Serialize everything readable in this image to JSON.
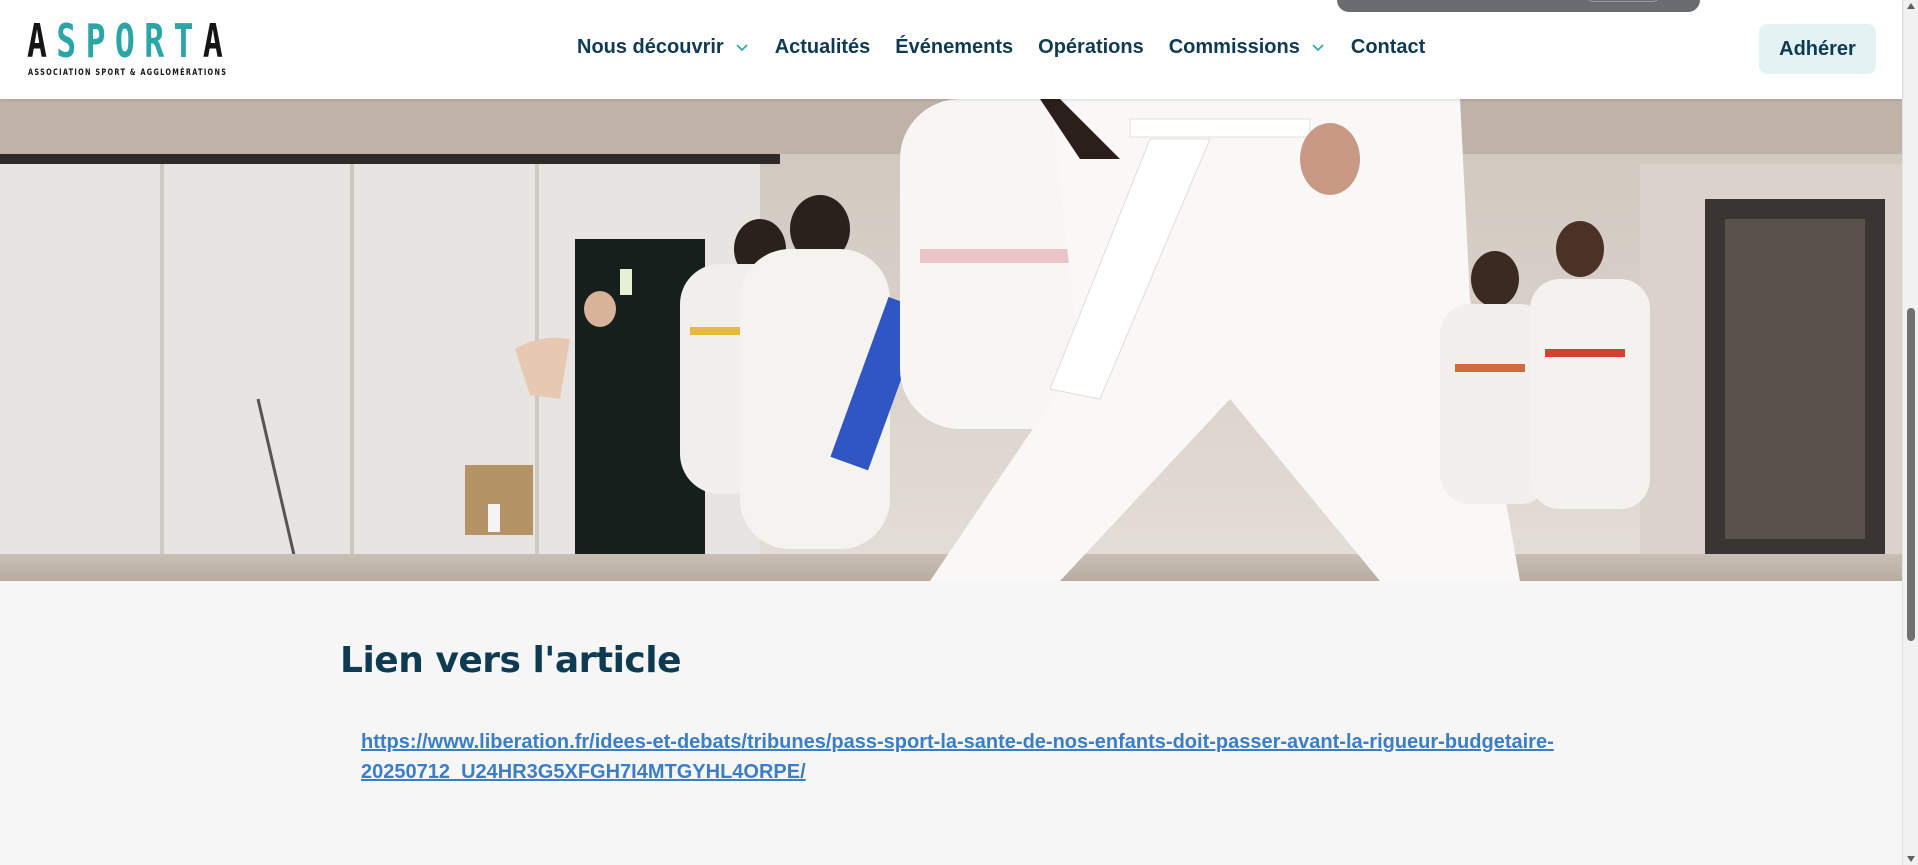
{
  "logo": {
    "word": "ASPORTA",
    "subtitle": "ASSOCIATION SPORT & AGGLOMÉRATIONS"
  },
  "nav": {
    "items": [
      {
        "label": "Nous découvrir",
        "has_dropdown": true
      },
      {
        "label": "Actualités",
        "has_dropdown": false
      },
      {
        "label": "Événements",
        "has_dropdown": false
      },
      {
        "label": "Opérations",
        "has_dropdown": false
      },
      {
        "label": "Commissions",
        "has_dropdown": true
      },
      {
        "label": "Contact",
        "has_dropdown": false
      }
    ]
  },
  "header": {
    "join_label": "Adhérer"
  },
  "hero": {
    "image_description_icon": "karate-class-photo"
  },
  "article": {
    "title": "Lien vers l'article",
    "link_text": "https://www.liberation.fr/idees-et-debats/tribunes/pass-sport-la-sante-de-nos-enfants-doit-passer-avant-la-rigueur-budgetaire-20250712_U24HR3G5XFGH7I4MTGYHL4ORPE/"
  },
  "colors": {
    "brand_dark": "#0e3a52",
    "brand_teal": "#2ba6a6",
    "link": "#3b7ec6",
    "join_bg": "#e3f3f3",
    "page_bg": "#f6f6f6"
  }
}
